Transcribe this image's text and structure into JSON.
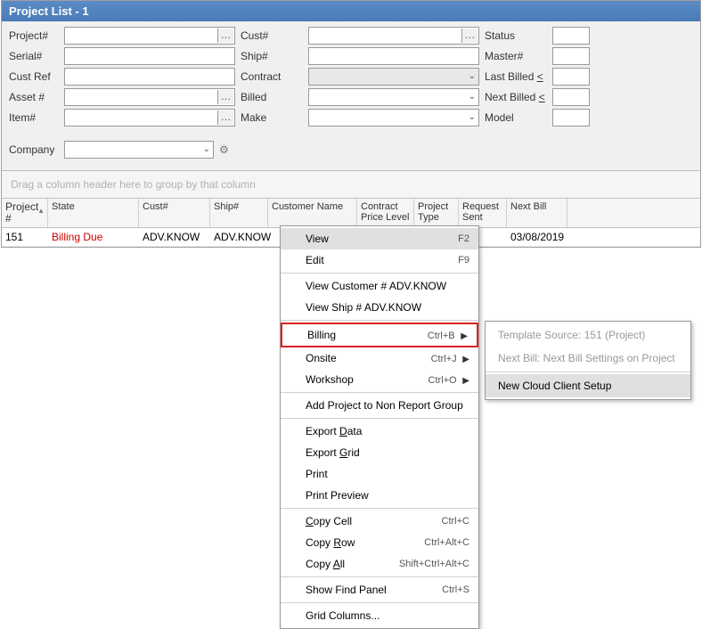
{
  "title": "Project List - 1",
  "filters": {
    "project": {
      "label": "Project#"
    },
    "serial": {
      "label": "Serial#"
    },
    "custref": {
      "label": "Cust Ref"
    },
    "asset": {
      "label": "Asset #"
    },
    "item": {
      "label": "Item#"
    },
    "cust": {
      "label": "Cust#"
    },
    "ship": {
      "label": "Ship#"
    },
    "contract": {
      "label": "Contract"
    },
    "billed": {
      "label": "Billed"
    },
    "make": {
      "label": "Make"
    },
    "status": {
      "label": "Status"
    },
    "master": {
      "label": "Master#"
    },
    "lastbilled": {
      "label": "Last Billed",
      "op": "<"
    },
    "nextbilled": {
      "label": "Next Billed",
      "op": "<"
    },
    "model": {
      "label": "Model"
    },
    "company": {
      "label": "Company"
    }
  },
  "groupHint": "Drag a column header here to group by that column",
  "columns": [
    "Project #",
    "State",
    "Cust#",
    "Ship#",
    "Customer Name",
    "Contract Price Level",
    "Project Type",
    "Request Sent",
    "Next Bill"
  ],
  "rows": [
    {
      "project": "151",
      "state": "Billing Due",
      "cust": "ADV.KNOW",
      "ship": "ADV.KNOW",
      "customerName": "",
      "contractPrice": "",
      "projectType": "",
      "requestSent": "",
      "nextBill": "03/08/2019"
    }
  ],
  "contextMenu": {
    "view": {
      "label": "View",
      "kbd": "F2"
    },
    "edit": {
      "label": "Edit",
      "kbd": "F9"
    },
    "viewCust": {
      "label": "View Customer # ADV.KNOW"
    },
    "viewShip": {
      "label": "View Ship # ADV.KNOW"
    },
    "billing": {
      "label": "Billing",
      "kbd": "Ctrl+B"
    },
    "onsite": {
      "label": "Onsite",
      "kbd": "Ctrl+J"
    },
    "workshop": {
      "label": "Workshop",
      "kbd": "Ctrl+O"
    },
    "addNonReport": {
      "label": "Add Project to Non Report Group"
    },
    "exportData": {
      "label": "Export Data"
    },
    "exportGrid": {
      "label": "Export Grid"
    },
    "print": {
      "label": "Print"
    },
    "printPreview": {
      "label": "Print Preview"
    },
    "copyCell": {
      "label": "Copy Cell",
      "kbd": "Ctrl+C"
    },
    "copyRow": {
      "label": "Copy Row",
      "kbd": "Ctrl+Alt+C"
    },
    "copyAll": {
      "label": "Copy All",
      "kbd": "Shift+Ctrl+Alt+C"
    },
    "showFind": {
      "label": "Show Find Panel",
      "kbd": "Ctrl+S"
    },
    "gridCols": {
      "label": "Grid Columns..."
    }
  },
  "submenu": {
    "template": {
      "label": "Template Source: 151 (Project)"
    },
    "nextBill": {
      "label": "Next Bill: Next Bill Settings on Project"
    },
    "newCloud": {
      "label": "New Cloud Client Setup"
    }
  }
}
